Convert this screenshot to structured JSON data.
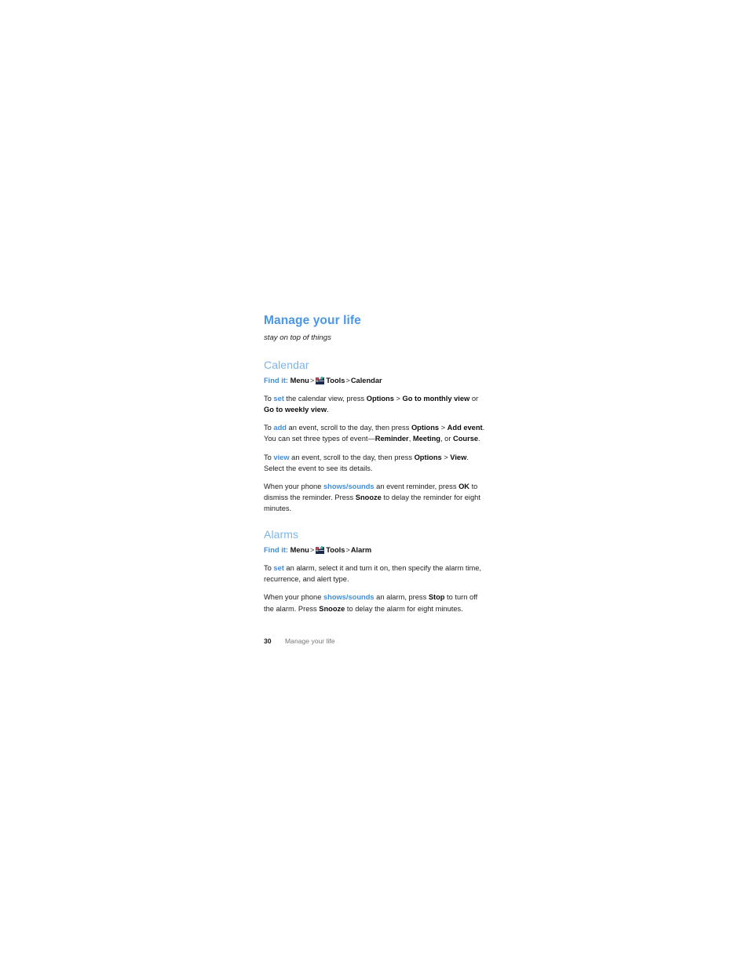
{
  "document": {
    "title": "Manage your life",
    "subtitle": "stay on top of things"
  },
  "sections": [
    {
      "heading": "Calendar",
      "find_it": {
        "label": "Find it:",
        "item1": "Menu",
        "sep1": ">",
        "icon": "tools-icon",
        "item2": "Tools",
        "sep2": ">",
        "item3": "Calendar"
      },
      "paragraphs": [
        {
          "p1_t1": "To ",
          "p1_a1": "set",
          "p1_t2": " the calendar view, press ",
          "p1_b1": "Options",
          "p1_t3": " > ",
          "p1_b2": "Go to monthly view",
          "p1_t4": " or ",
          "p1_b3": "Go to weekly view",
          "p1_t5": "."
        },
        {
          "p2_t1": "To ",
          "p2_a1": "add",
          "p2_t2": " an event, scroll to the day, then press ",
          "p2_b1": "Options",
          "p2_t3": " > ",
          "p2_b2": "Add event",
          "p2_t4": ". You can set three types of event—",
          "p2_b3": "Reminder",
          "p2_t5": ", ",
          "p2_b4": "Meeting",
          "p2_t6": ", or ",
          "p2_b5": "Course",
          "p2_t7": "."
        },
        {
          "p3_t1": "To ",
          "p3_a1": "view",
          "p3_t2": " an event, scroll to the day, then press ",
          "p3_b1": "Options",
          "p3_t3": " > ",
          "p3_b2": "View",
          "p3_t4": ". Select the event to see its details."
        },
        {
          "p4_t1": "When your phone ",
          "p4_a1": "shows/sounds",
          "p4_t2": " an event reminder, press ",
          "p4_b1": "OK",
          "p4_t3": " to dismiss the reminder. Press ",
          "p4_b2": "Snooze",
          "p4_t4": " to delay the reminder for eight minutes."
        }
      ]
    },
    {
      "heading": "Alarms",
      "find_it": {
        "label": "Find it:",
        "item1": "Menu",
        "sep1": ">",
        "icon": "tools-icon",
        "item2": "Tools",
        "sep2": ">",
        "item3": "Alarm"
      },
      "paragraphs": [
        {
          "p1_t1": "To ",
          "p1_a1": "set",
          "p1_t2": " an alarm, select it and turn it on, then specify the alarm time, recurrence, and alert type."
        },
        {
          "p2_t1": "When your phone ",
          "p2_a1": "shows/sounds",
          "p2_t2": " an alarm, press ",
          "p2_b1": "Stop",
          "p2_t3": " to turn off the alarm. Press ",
          "p2_b2": "Snooze",
          "p2_t4": " to delay the alarm for eight minutes."
        }
      ]
    }
  ],
  "footer": {
    "page_number": "30",
    "title": "Manage your life"
  },
  "colors": {
    "title_blue": "#4a96e8",
    "heading_blue": "#7cb5e8",
    "accent_blue": "#3d8ee0",
    "body_text": "#1d1d1d",
    "footer_gray": "#77777a",
    "page_background": "#ffffff"
  }
}
